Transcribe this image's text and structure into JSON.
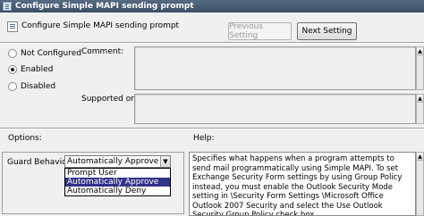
{
  "window": {
    "title": "Configure Simple MAPI sending prompt"
  },
  "header": {
    "setting_name": "Configure Simple MAPI sending prompt"
  },
  "buttons": {
    "previous": "Previous Setting",
    "next": "Next Setting"
  },
  "state": {
    "options": [
      {
        "label": "Not Configured",
        "selected": false
      },
      {
        "label": "Enabled",
        "selected": true
      },
      {
        "label": "Disabled",
        "selected": false
      }
    ]
  },
  "labels": {
    "comment": "Comment:",
    "supported_on": "Supported on:",
    "options": "Options:",
    "help": "Help:"
  },
  "guard": {
    "label": "Guard Behavior:",
    "selected_value": "Automatically Approve",
    "options": [
      "Prompt User",
      "Automatically Approve",
      "Automatically Deny"
    ],
    "highlighted_index": 1
  },
  "help_text": "Specifies what happens when a program attempts to send mail programmatically using Simple MAPI. To set Exchange Security Form settings by using Group Policy instead, you must enable the Outlook Security Mode setting in \\Security Form Settings \\Microsoft Office Outlook 2007 Security and select the Use Outlook Security Group Policy check box.",
  "colors": {
    "titlebar": "#4a5d75",
    "dropdown_highlight": "#33338a"
  }
}
